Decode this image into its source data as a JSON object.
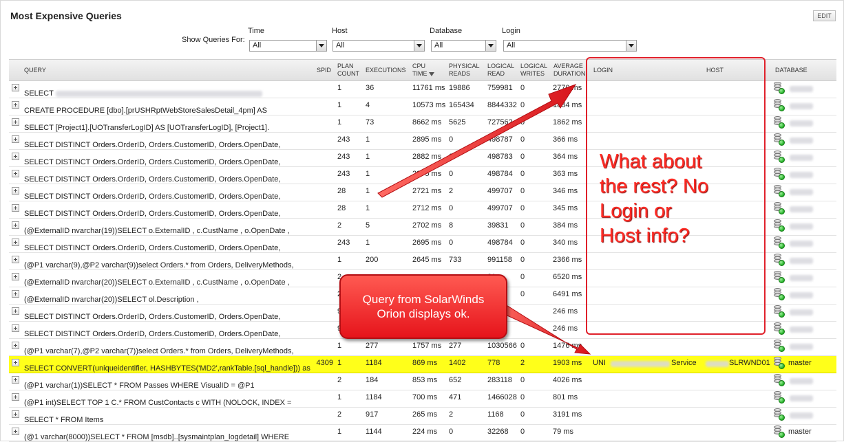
{
  "title": "Most Expensive Queries",
  "edit_label": "EDIT",
  "filters": {
    "show_label": "Show Queries For:",
    "items": [
      {
        "label": "Time",
        "value": "All"
      },
      {
        "label": "Host",
        "value": "All"
      },
      {
        "label": "Database",
        "value": "All"
      },
      {
        "label": "Login",
        "value": "All"
      }
    ]
  },
  "columns": {
    "query": "QUERY",
    "spid": "SPID",
    "plan_count": [
      "PLAN",
      "COUNT"
    ],
    "executions": "EXECUTIONS",
    "cpu_time": [
      "CPU",
      "TIME"
    ],
    "physical_reads": [
      "PHYSICAL",
      "READS"
    ],
    "logical_read": [
      "LOGICAL",
      "READ"
    ],
    "logical_writes": [
      "LOGICAL",
      "WRITES"
    ],
    "average_duration": [
      "AVERAGE",
      "DURATION"
    ],
    "login": "LOGIN",
    "host": "HOST",
    "database": "DATABASE"
  },
  "rows": [
    {
      "query": "SELECT",
      "spid": "",
      "plan": "1",
      "exec": "36",
      "cpu": "11761 ms",
      "phys": "19886",
      "lread": "759981",
      "lwrite": "0",
      "dur": "2770 ms",
      "login": "",
      "host": "",
      "db": ""
    },
    {
      "query": " CREATE PROCEDURE [dbo].[prUSHRptWebStoreSalesDetail_4pm] AS",
      "spid": "",
      "plan": "1",
      "exec": "4",
      "cpu": "10573 ms",
      "phys": "165434",
      "lread": "8844332",
      "lwrite": "0",
      "dur": "1884 ms",
      "login": "",
      "host": "",
      "db": ""
    },
    {
      "query": "SELECT  [Project1].[UOTransferLogID] AS [UOTransferLogID],  [Project1].",
      "spid": "",
      "plan": "1",
      "exec": "73",
      "cpu": "8662 ms",
      "phys": "5625",
      "lread": "727562",
      "lwrite": "0",
      "dur": "1862 ms",
      "login": "",
      "host": "",
      "db": ""
    },
    {
      "query": "SELECT DISTINCT Orders.OrderID, Orders.CustomerID, Orders.OpenDate,",
      "spid": "",
      "plan": "243",
      "exec": "1",
      "cpu": "2895 ms",
      "phys": "0",
      "lread": "498787",
      "lwrite": "0",
      "dur": "366 ms",
      "login": "",
      "host": "",
      "db": ""
    },
    {
      "query": "SELECT DISTINCT Orders.OrderID, Orders.CustomerID, Orders.OpenDate,",
      "spid": "",
      "plan": "243",
      "exec": "1",
      "cpu": "2882 ms",
      "phys": "0",
      "lread": "498783",
      "lwrite": "0",
      "dur": "364 ms",
      "login": "",
      "host": "",
      "db": ""
    },
    {
      "query": "SELECT DISTINCT Orders.OrderID, Orders.CustomerID, Orders.OpenDate,",
      "spid": "",
      "plan": "243",
      "exec": "1",
      "cpu": "2875 ms",
      "phys": "0",
      "lread": "498784",
      "lwrite": "0",
      "dur": "363 ms",
      "login": "",
      "host": "",
      "db": ""
    },
    {
      "query": "SELECT DISTINCT Orders.OrderID, Orders.CustomerID, Orders.OpenDate,",
      "spid": "",
      "plan": "28",
      "exec": "1",
      "cpu": "2721 ms",
      "phys": "2",
      "lread": "499707",
      "lwrite": "0",
      "dur": "346 ms",
      "login": "",
      "host": "",
      "db": ""
    },
    {
      "query": "SELECT DISTINCT Orders.OrderID, Orders.CustomerID, Orders.OpenDate,",
      "spid": "",
      "plan": "28",
      "exec": "1",
      "cpu": "2712 ms",
      "phys": "0",
      "lread": "499707",
      "lwrite": "0",
      "dur": "345 ms",
      "login": "",
      "host": "",
      "db": ""
    },
    {
      "query": "(@ExternalID nvarchar(19))SELECT o.ExternalID , c.CustName , o.OpenDate ,",
      "spid": "",
      "plan": "2",
      "exec": "5",
      "cpu": "2702 ms",
      "phys": "8",
      "lread": "39831",
      "lwrite": "0",
      "dur": "384 ms",
      "login": "",
      "host": "",
      "db": ""
    },
    {
      "query": "SELECT DISTINCT Orders.OrderID, Orders.CustomerID, Orders.OpenDate,",
      "spid": "",
      "plan": "243",
      "exec": "1",
      "cpu": "2695 ms",
      "phys": "0",
      "lread": "498784",
      "lwrite": "0",
      "dur": "340 ms",
      "login": "",
      "host": "",
      "db": ""
    },
    {
      "query": "(@P1 varchar(9),@P2 varchar(9))select Orders.* from Orders, DeliveryMethods,",
      "spid": "",
      "plan": "1",
      "exec": "200",
      "cpu": "2645 ms",
      "phys": "733",
      "lread": "991158",
      "lwrite": "0",
      "dur": "2366 ms",
      "login": "",
      "host": "",
      "db": ""
    },
    {
      "query": "(@ExternalID nvarchar(20))SELECT o.ExternalID , c.CustName , o.OpenDate ,",
      "spid": "",
      "plan": "2",
      "exec": "",
      "cpu": "",
      "phys": "",
      "lread": "31",
      "lwrite": "0",
      "dur": "6520 ms",
      "login": "",
      "host": "",
      "db": ""
    },
    {
      "query": "(@ExternalID nvarchar(20))SELECT ol.Description ,",
      "spid": "",
      "plan": "2",
      "exec": "",
      "cpu": "",
      "phys": "",
      "lread": "",
      "lwrite": "0",
      "dur": "6491 ms",
      "login": "",
      "host": "",
      "db": ""
    },
    {
      "query": "SELECT DISTINCT Orders.OrderID, Orders.CustomerID, Orders.OpenDate,",
      "spid": "",
      "plan": "9",
      "exec": "",
      "cpu": "",
      "phys": "",
      "lread": "",
      "lwrite": "",
      "dur": "246 ms",
      "login": "",
      "host": "",
      "db": ""
    },
    {
      "query": "SELECT DISTINCT Orders.OrderID, Orders.CustomerID, Orders.OpenDate,",
      "spid": "",
      "plan": "9",
      "exec": "",
      "cpu": "",
      "phys": "",
      "lread": "2",
      "lwrite": "",
      "dur": "246 ms",
      "login": "",
      "host": "",
      "db": ""
    },
    {
      "query": "(@P1 varchar(7),@P2 varchar(7))select Orders.* from Orders, DeliveryMethods,",
      "spid": "",
      "plan": "1",
      "exec": "277",
      "cpu": "1757 ms",
      "phys": "277",
      "lread": "1030566",
      "lwrite": "0",
      "dur": "1476 ms",
      "login": "",
      "host": "",
      "db": ""
    },
    {
      "query": "SELECT CONVERT(uniqueidentifier, HASHBYTES('MD2',rankTable.[sql_handle])) as",
      "spid": "4309",
      "plan": "1",
      "exec": "1184",
      "cpu": "869 ms",
      "phys": "1402",
      "lread": "778",
      "lwrite": "2",
      "dur": "1903 ms",
      "login": "UNI",
      "host": "Service",
      "host_tail": "SLRWND01",
      "db": "master",
      "highlight": true
    },
    {
      "query": "(@P1 varchar(1))SELECT * FROM Passes WHERE VisualID = @P1",
      "spid": "",
      "plan": "2",
      "exec": "184",
      "cpu": "853 ms",
      "phys": "652",
      "lread": "283118",
      "lwrite": "0",
      "dur": "4026 ms",
      "login": "",
      "host": "",
      "db": ""
    },
    {
      "query": "(@P1 int)SELECT TOP 1 C.* FROM CustContacts c WITH (NOLOCK, INDEX =",
      "spid": "",
      "plan": "1",
      "exec": "1184",
      "cpu": "700 ms",
      "phys": "471",
      "lread": "1466028",
      "lwrite": "0",
      "dur": "801 ms",
      "login": "",
      "host": "",
      "db": ""
    },
    {
      "query": "SELECT * FROM Items",
      "spid": "",
      "plan": "2",
      "exec": "917",
      "cpu": "265 ms",
      "phys": "2",
      "lread": "1168",
      "lwrite": "0",
      "dur": "3191 ms",
      "login": "",
      "host": "",
      "db": ""
    },
    {
      "query": "(@1 varchar(8000))SELECT * FROM [msdb]..[sysmaintplan_logdetail] WHERE",
      "spid": "",
      "plan": "1",
      "exec": "1144",
      "cpu": "224 ms",
      "phys": "0",
      "lread": "32268",
      "lwrite": "0",
      "dur": "79 ms",
      "login": "",
      "host": "",
      "db": "master"
    }
  ],
  "annotations": {
    "callout": [
      "What about",
      "the rest? No",
      "Login or",
      "Host info?"
    ],
    "bubble": [
      "Query from SolarWinds",
      "Orion displays ok."
    ],
    "color": "#ff2a23"
  }
}
